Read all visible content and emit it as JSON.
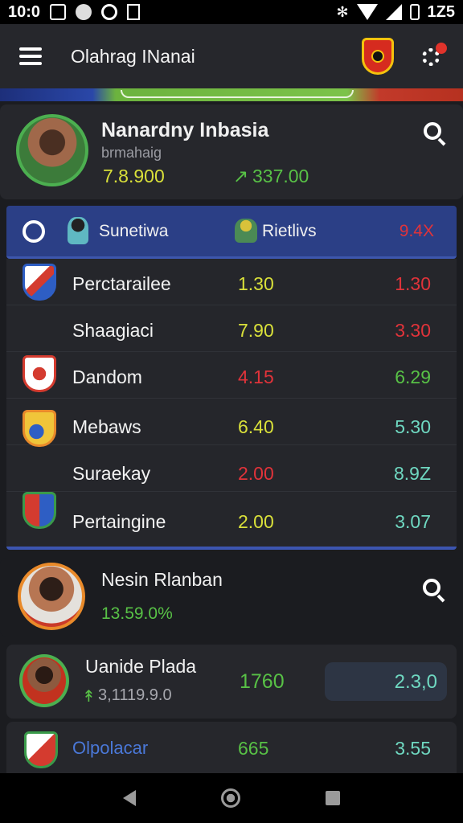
{
  "status_bar": {
    "time": "10:0",
    "battery_text": "1Z5"
  },
  "app_bar": {
    "title": "Olahrag INanai"
  },
  "profile": {
    "name": "Nanardny Inbasia",
    "subtitle": "brmahaig",
    "stat_left": "7.8.900",
    "stat_right": "337.00",
    "stat_right_prefix": "↗"
  },
  "table": {
    "header": {
      "col1": "Sunetiwa",
      "col2": "Rietlivs",
      "col3": "9.4X"
    },
    "rows": [
      {
        "name": "Perctarailee",
        "v1": "1.30",
        "v1_color": "yellow",
        "v2": "1.30",
        "v2_color": "red",
        "crest": "blue",
        "has_crest": true
      },
      {
        "name": "Shaagiaci",
        "v1": "7.90",
        "v1_color": "yellow",
        "v2": "3.30",
        "v2_color": "red",
        "crest": "",
        "has_crest": false
      },
      {
        "name": "Dandom",
        "v1": "4.15",
        "v1_color": "red",
        "v2": "6.29",
        "v2_color": "green",
        "crest": "red",
        "has_crest": true
      },
      {
        "name": "Mebaws",
        "v1": "6.40",
        "v1_color": "yellow",
        "v2": "5.30",
        "v2_color": "cyan",
        "crest": "orange",
        "has_crest": true
      },
      {
        "name": "Suraekay",
        "v1": "2.00",
        "v1_color": "red",
        "v2": "8.9Z",
        "v2_color": "cyan",
        "crest": "",
        "has_crest": false
      },
      {
        "name": "Pertaingine",
        "v1": "2.00",
        "v1_color": "yellow",
        "v2": "3.07",
        "v2_color": "cyan",
        "crest": "green",
        "has_crest": true
      }
    ]
  },
  "player_card_2": {
    "name": "Nesin Rlanban",
    "value": "13.59.0%"
  },
  "player_card_3": {
    "name": "Uanide Plada",
    "sub": "3,1119.9.0",
    "sub_prefix": "↟",
    "stat": "1760",
    "pill": "2.3,0"
  },
  "club_row": {
    "name": "Olpolacar",
    "v1": "665",
    "v2": "3.55"
  },
  "colors": {
    "accent_blue": "#2b3f86",
    "green": "#58c146",
    "red": "#e0333a",
    "yellow": "#d9e03a"
  }
}
